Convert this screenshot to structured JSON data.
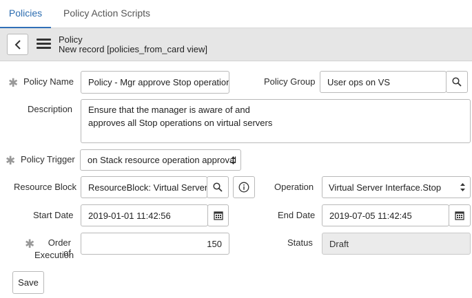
{
  "tabs": [
    {
      "label": "Policies",
      "active": true
    },
    {
      "label": "Policy Action Scripts",
      "active": false
    }
  ],
  "header": {
    "title": "Policy",
    "subtitle": "New record [policies_from_card view]"
  },
  "form": {
    "policy_name": {
      "label": "Policy Name",
      "value": "Policy - Mgr approve Stop operation",
      "required": true
    },
    "policy_group": {
      "label": "Policy Group",
      "value": "User ops on VS"
    },
    "description": {
      "label": "Description",
      "line1": "Ensure that the manager is aware of and",
      "line2": "approves all Stop operations on virtual servers"
    },
    "policy_trigger": {
      "label": "Policy Trigger",
      "value": "on Stack resource operation approval",
      "required": true
    },
    "resource_block": {
      "label": "Resource Block",
      "value": "ResourceBlock: Virtual Server"
    },
    "operation": {
      "label": "Operation",
      "value": "Virtual Server Interface.Stop"
    },
    "start_date": {
      "label": "Start Date",
      "value": "2019-01-01 11:42:56"
    },
    "end_date": {
      "label": "End Date",
      "value": "2019-07-05 11:42:45"
    },
    "order": {
      "label_line1": "Order of",
      "label_line2": "Execution",
      "value": "150",
      "required": true
    },
    "status": {
      "label": "Status",
      "value": "Draft"
    },
    "save_label": "Save"
  },
  "colors": {
    "accent": "#2f6fb7",
    "header_bg": "#e6e6e6",
    "readonly_bg": "#ebebeb"
  },
  "icons": [
    "chevron-left-icon",
    "hamburger-menu-icon",
    "search-icon",
    "info-icon",
    "calendar-icon",
    "select-arrows-icon",
    "required-asterisk-icon"
  ]
}
